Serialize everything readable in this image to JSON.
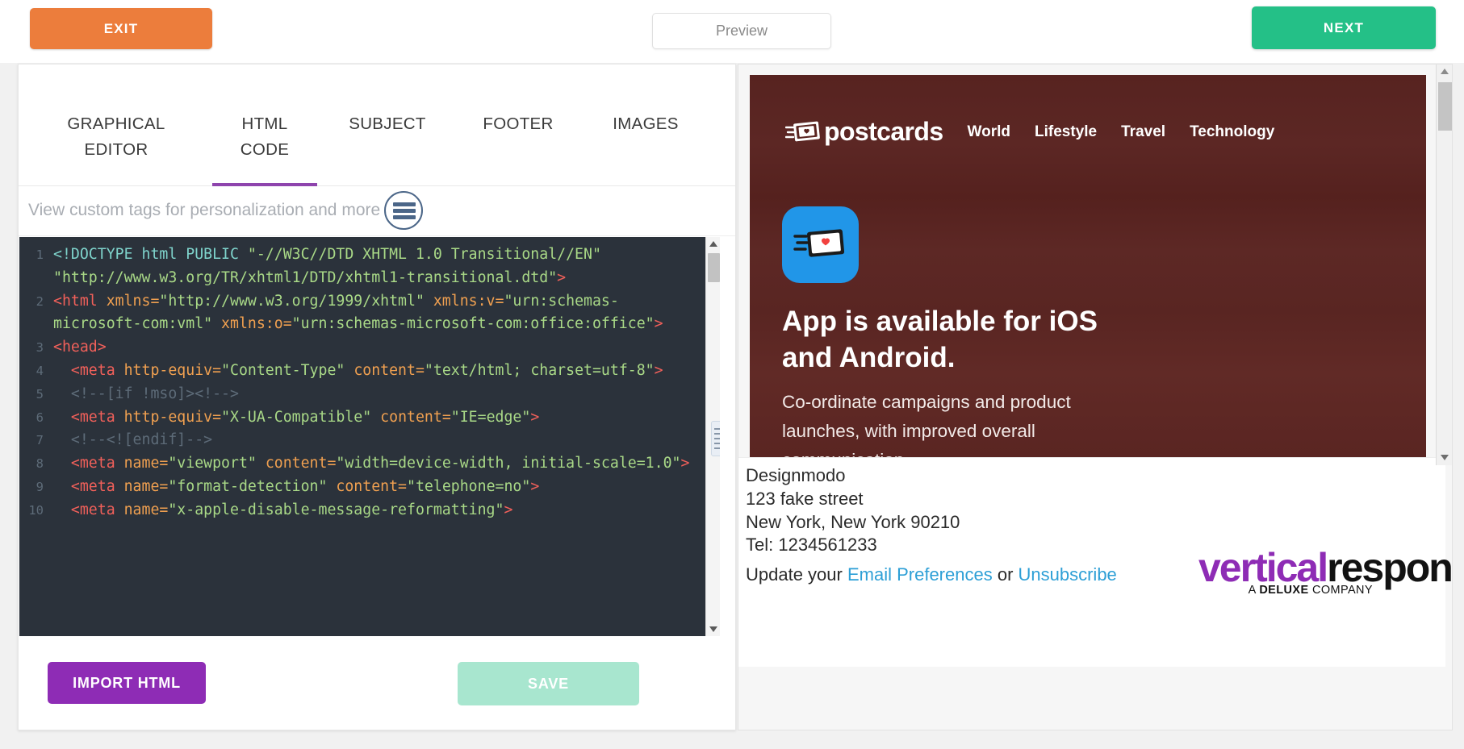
{
  "toolbar": {
    "exit_label": "EXIT",
    "preview_label": "Preview",
    "next_label": "NEXT"
  },
  "editor": {
    "tabs": [
      {
        "line1": "GRAPHICAL",
        "line2": "EDITOR",
        "active": false
      },
      {
        "line1": "HTML",
        "line2": "CODE",
        "active": true
      },
      {
        "line1": "SUBJECT",
        "line2": "",
        "active": false
      },
      {
        "line1": "FOOTER",
        "line2": "",
        "active": false
      },
      {
        "line1": "IMAGES",
        "line2": "",
        "active": false
      }
    ],
    "tagbar_label": "View custom tags for personalization and more",
    "tagbar_icon": "hamburger-menu-icon",
    "code_lines": [
      {
        "number": "1",
        "tokens": [
          {
            "t": "doctype",
            "s": "<!DOCTYPE html PUBLIC "
          },
          {
            "t": "val",
            "s": "\"-//W3C//DTD XHTML 1.0 Transitional//EN\" \"http://www.w3.org/TR/xhtml1/DTD/xhtml1-transitional.dtd\""
          },
          {
            "t": "punct",
            "s": ">"
          }
        ]
      },
      {
        "number": "2",
        "tokens": [
          {
            "t": "tag",
            "s": "<html "
          },
          {
            "t": "attr",
            "s": "xmlns="
          },
          {
            "t": "val",
            "s": "\"http://www.w3.org/1999/xhtml\" "
          },
          {
            "t": "attr",
            "s": "xmlns:v="
          },
          {
            "t": "val",
            "s": "\"urn:schemas-microsoft-com:vml\" "
          },
          {
            "t": "attr",
            "s": "xmlns:o="
          },
          {
            "t": "val",
            "s": "\"urn:schemas-microsoft-com:office:office\""
          },
          {
            "t": "punct",
            "s": ">"
          }
        ]
      },
      {
        "number": "3",
        "tokens": [
          {
            "t": "tag",
            "s": "<head>"
          }
        ]
      },
      {
        "number": "4",
        "tokens": [
          {
            "t": "plain",
            "s": "  "
          },
          {
            "t": "tag",
            "s": "<meta "
          },
          {
            "t": "attr",
            "s": "http-equiv="
          },
          {
            "t": "val",
            "s": "\"Content-Type\" "
          },
          {
            "t": "attr",
            "s": "content="
          },
          {
            "t": "val",
            "s": "\"text/html; charset=utf-8\""
          },
          {
            "t": "punct",
            "s": ">"
          }
        ]
      },
      {
        "number": "5",
        "tokens": [
          {
            "t": "plain",
            "s": "  "
          },
          {
            "t": "comment",
            "s": "<!--[if !mso]><!-->"
          }
        ]
      },
      {
        "number": "6",
        "tokens": [
          {
            "t": "plain",
            "s": "  "
          },
          {
            "t": "tag",
            "s": "<meta "
          },
          {
            "t": "attr",
            "s": "http-equiv="
          },
          {
            "t": "val",
            "s": "\"X-UA-Compatible\" "
          },
          {
            "t": "attr",
            "s": "content="
          },
          {
            "t": "val",
            "s": "\"IE=edge\""
          },
          {
            "t": "punct",
            "s": ">"
          }
        ]
      },
      {
        "number": "7",
        "tokens": [
          {
            "t": "plain",
            "s": "  "
          },
          {
            "t": "comment",
            "s": "<!--<![endif]-->"
          }
        ]
      },
      {
        "number": "8",
        "tokens": [
          {
            "t": "plain",
            "s": "  "
          },
          {
            "t": "tag",
            "s": "<meta "
          },
          {
            "t": "attr",
            "s": "name="
          },
          {
            "t": "val",
            "s": "\"viewport\" "
          },
          {
            "t": "attr",
            "s": "content="
          },
          {
            "t": "val",
            "s": "\"width=device-width, initial-scale=1.0\""
          },
          {
            "t": "punct",
            "s": ">"
          }
        ]
      },
      {
        "number": "9",
        "tokens": [
          {
            "t": "plain",
            "s": "  "
          },
          {
            "t": "tag",
            "s": "<meta "
          },
          {
            "t": "attr",
            "s": "name="
          },
          {
            "t": "val",
            "s": "\"format-detection\" "
          },
          {
            "t": "attr",
            "s": "content="
          },
          {
            "t": "val",
            "s": "\"telephone=no\""
          },
          {
            "t": "punct",
            "s": ">"
          }
        ]
      },
      {
        "number": "10",
        "tokens": [
          {
            "t": "plain",
            "s": "  "
          },
          {
            "t": "tag",
            "s": "<meta "
          },
          {
            "t": "attr",
            "s": "name="
          },
          {
            "t": "val",
            "s": "\"x-apple-disable-message-reformatting\""
          },
          {
            "t": "punct",
            "s": ">"
          }
        ]
      }
    ],
    "import_label": "IMPORT HTML",
    "save_label": "SAVE"
  },
  "preview": {
    "brand_name": "postcards",
    "brand_mark_icon": "postcard-heart-icon",
    "nav": [
      "World",
      "Lifestyle",
      "Travel",
      "Technology"
    ],
    "app_icon": "postcard-app-icon",
    "hero_title": "App is available for iOS and Android.",
    "hero_body": "Co-ordinate campaigns and product launches, with improved overall communication.",
    "footer": {
      "address_lines": [
        "Designmodo",
        "123 fake street",
        "New York, New York 90210",
        "Tel: 1234561233"
      ],
      "update_prefix": "Update your ",
      "email_preferences_label": "Email Preferences",
      "or_label": " or ",
      "unsubscribe_label": "Unsubscribe",
      "vr_logo_part1": "vertical",
      "vr_logo_part2": "response",
      "vr_tagline_a": "A ",
      "vr_tagline_b": "DELUXE",
      "vr_tagline_c": " COMPANY"
    }
  },
  "colors": {
    "exit_orange": "#ec7d3c",
    "next_green": "#24c087",
    "tab_accent_purple": "#8e44ad",
    "import_purple": "#8e2cb5",
    "save_mint": "#a8e6cf",
    "email_bg_brown": "#5a2420",
    "link_blue": "#2d9fd6",
    "app_icon_blue": "#2196e8"
  }
}
